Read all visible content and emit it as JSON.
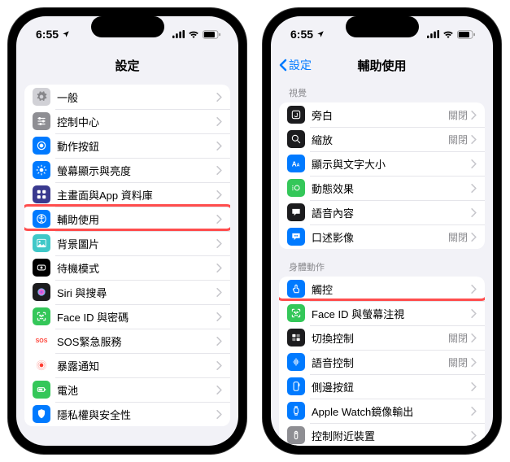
{
  "status": {
    "time": "6:55",
    "loc_icon": "loc"
  },
  "left": {
    "title": "設定",
    "rows": [
      {
        "icon": "gear",
        "bg": "#d1d1d6",
        "label": "一般"
      },
      {
        "icon": "sliders",
        "bg": "#8e8e93",
        "label": "控制中心"
      },
      {
        "icon": "action",
        "bg": "#007aff",
        "label": "動作按鈕"
      },
      {
        "icon": "bright",
        "bg": "#007aff",
        "label": "螢幕顯示與亮度"
      },
      {
        "icon": "grid",
        "bg": "#3a3a8f",
        "label": "主畫面與App 資料庫"
      },
      {
        "icon": "access",
        "bg": "#007aff",
        "label": "輔助使用"
      },
      {
        "icon": "wall",
        "bg": "#40c8c8",
        "label": "背景圖片"
      },
      {
        "icon": "standby",
        "bg": "#000000",
        "label": "待機模式"
      },
      {
        "icon": "siri",
        "bg": "#1c1c1e",
        "label": "Siri 與搜尋"
      },
      {
        "icon": "faceid",
        "bg": "#34c759",
        "label": "Face ID 與密碼"
      },
      {
        "icon": "sos",
        "bg": "#ffffff",
        "label": "SOS緊急服務",
        "fg": "#ff3b30",
        "txt": "SOS"
      },
      {
        "icon": "exposure",
        "bg": "#ffffff",
        "label": "暴露通知",
        "fg": "#ff3b30"
      },
      {
        "icon": "battery",
        "bg": "#34c759",
        "label": "電池"
      },
      {
        "icon": "privacy",
        "bg": "#007aff",
        "label": "隱私權與安全性"
      }
    ],
    "highlight_index": 5
  },
  "right": {
    "back": "設定",
    "title": "輔助使用",
    "sections": [
      {
        "header": "視覺",
        "rows": [
          {
            "icon": "voiceover",
            "bg": "#1c1c1e",
            "label": "旁白",
            "value": "關閉"
          },
          {
            "icon": "zoom",
            "bg": "#1c1c1e",
            "label": "縮放",
            "value": "關閉"
          },
          {
            "icon": "textsize",
            "bg": "#007aff",
            "label": "顯示與文字大小"
          },
          {
            "icon": "motion",
            "bg": "#34c759",
            "label": "動態效果"
          },
          {
            "icon": "speech",
            "bg": "#1c1c1e",
            "label": "語音內容"
          },
          {
            "icon": "audiodesc",
            "bg": "#007aff",
            "label": "口述影像",
            "value": "關閉"
          }
        ]
      },
      {
        "header": "身體動作",
        "rows": [
          {
            "icon": "touch",
            "bg": "#007aff",
            "label": "觸控"
          },
          {
            "icon": "faceid",
            "bg": "#34c759",
            "label": "Face ID 與螢幕注視"
          },
          {
            "icon": "switch",
            "bg": "#1c1c1e",
            "label": "切換控制",
            "value": "關閉"
          },
          {
            "icon": "voicectl",
            "bg": "#007aff",
            "label": "語音控制",
            "value": "關閉"
          },
          {
            "icon": "sidebtn",
            "bg": "#007aff",
            "label": "側邊按鈕"
          },
          {
            "icon": "watch",
            "bg": "#007aff",
            "label": "Apple Watch鏡像輸出"
          },
          {
            "icon": "remote",
            "bg": "#8e8e93",
            "label": "控制附近裝置"
          }
        ],
        "highlight_index": 0
      }
    ]
  }
}
